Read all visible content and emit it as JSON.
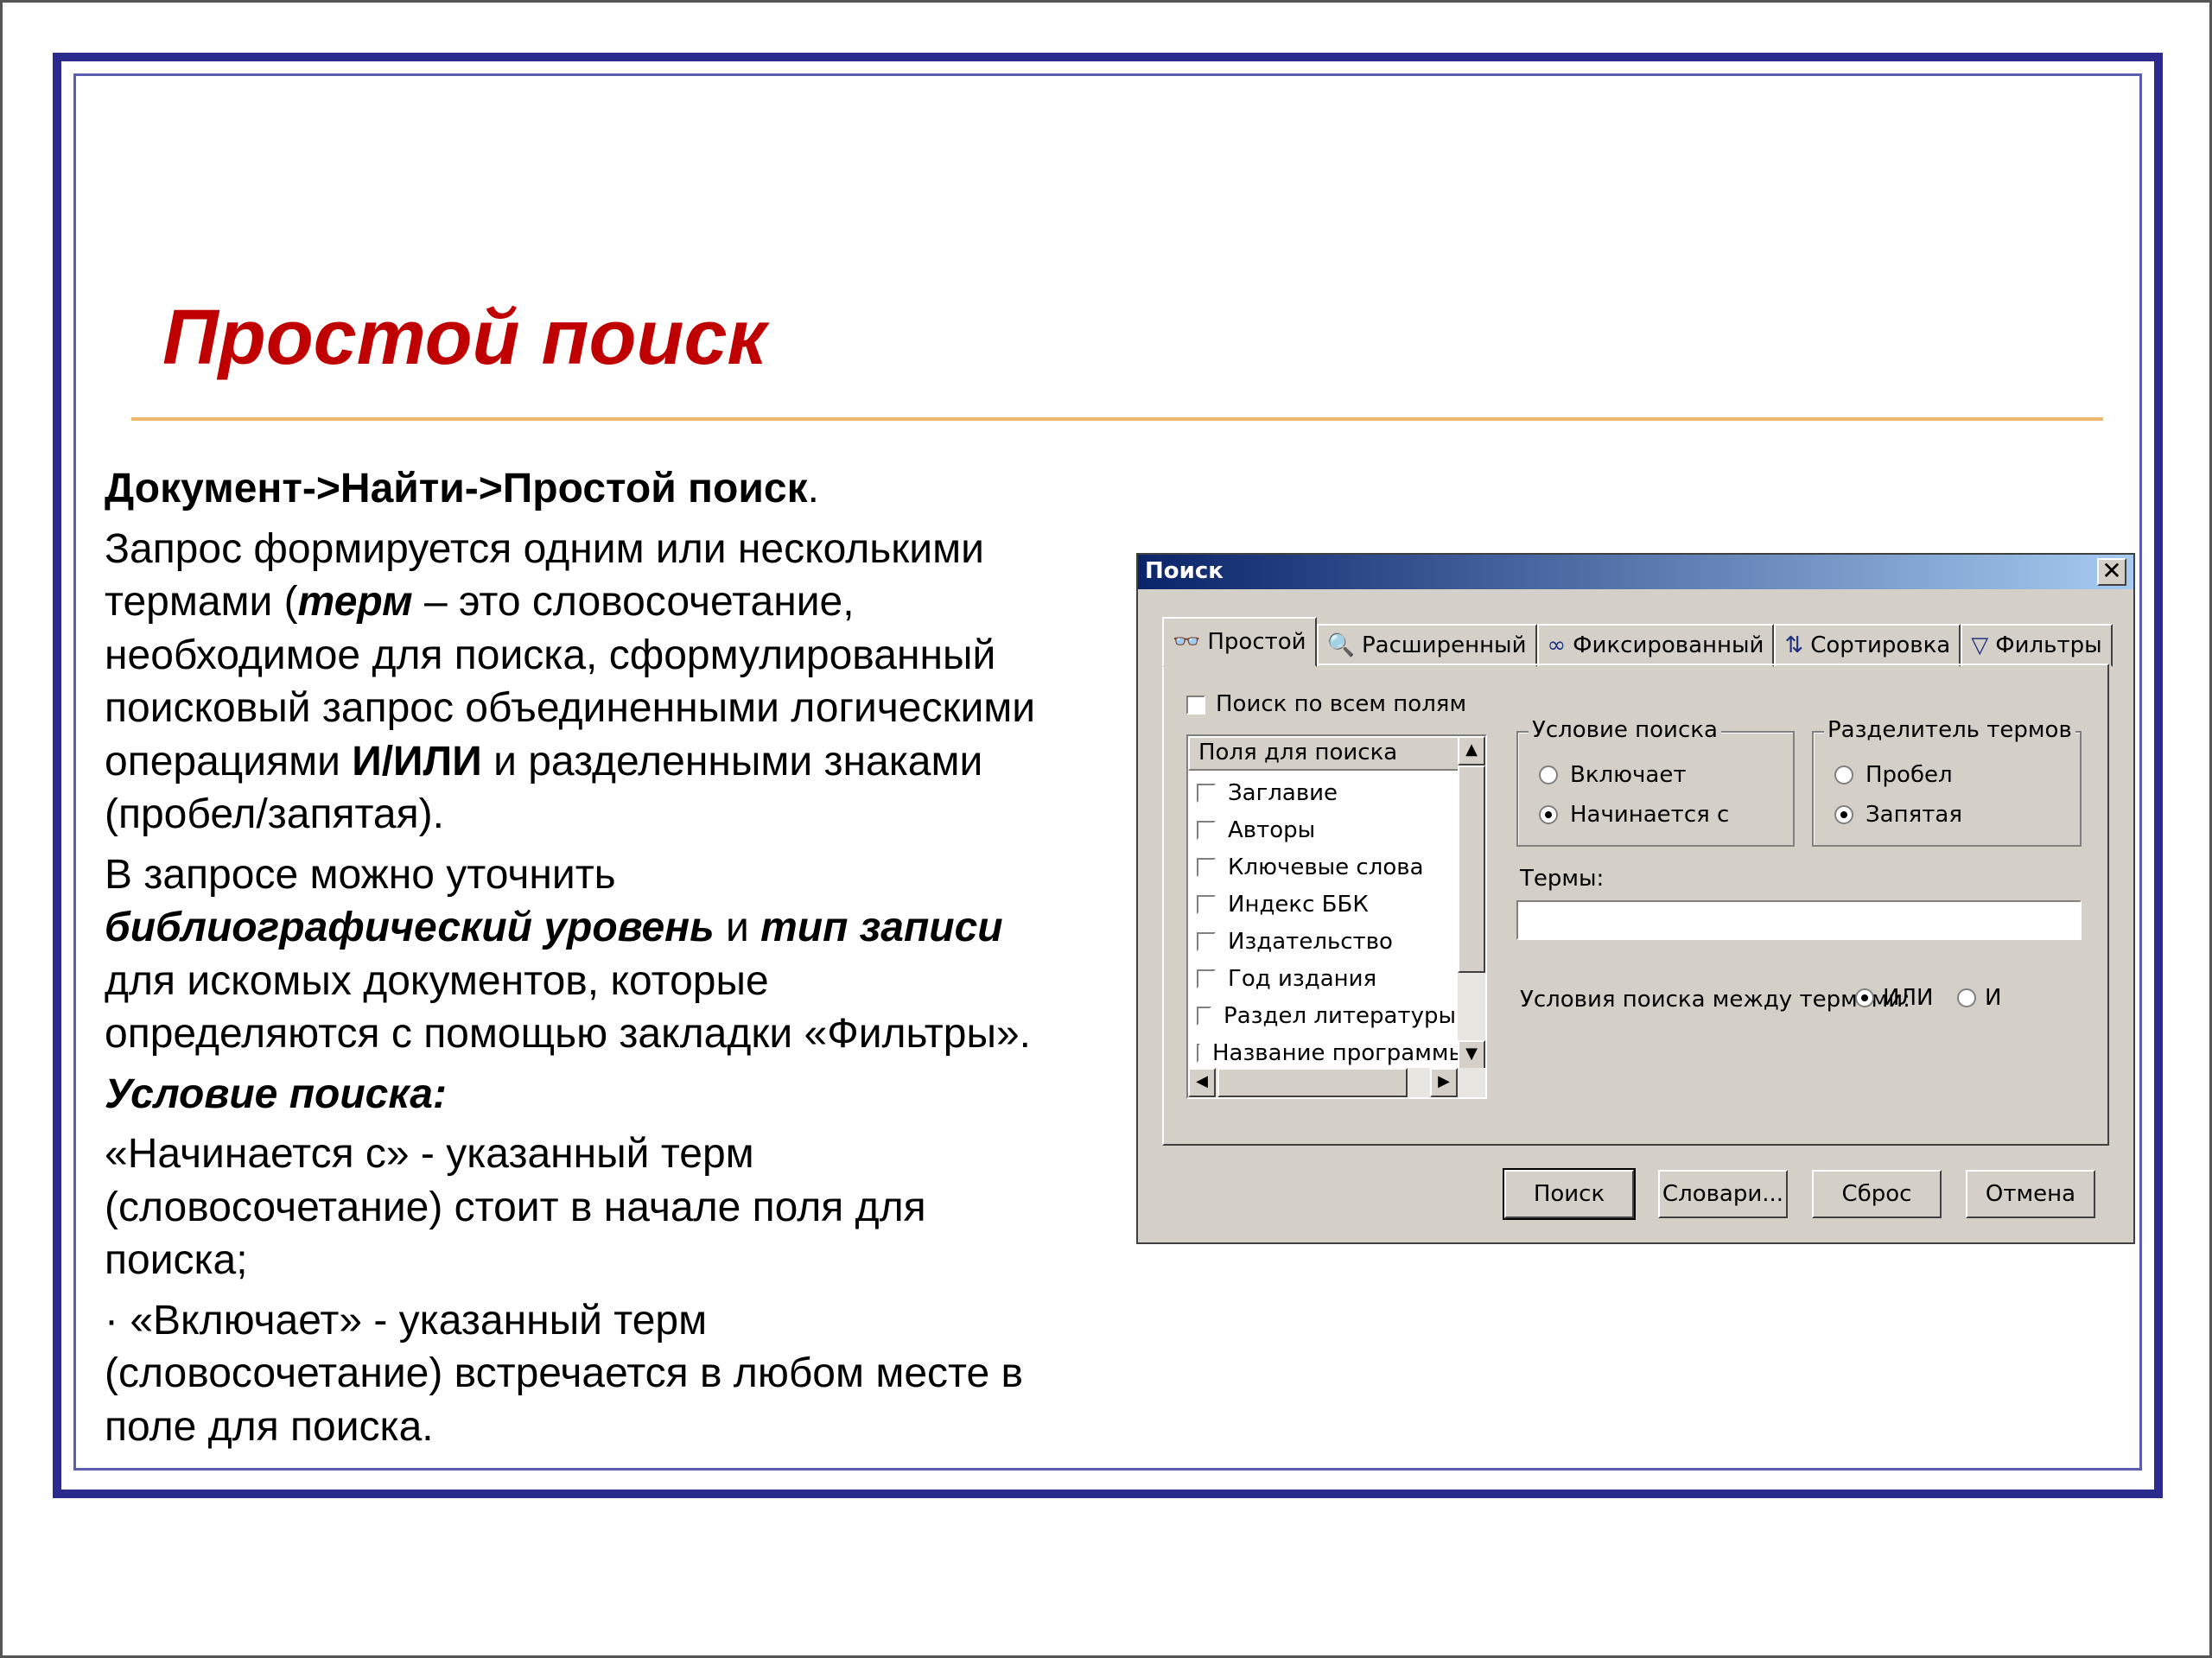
{
  "slide": {
    "title": "Простой поиск",
    "path": "Документ->Найти->Простой поиск",
    "path_dot": ".",
    "p1_a": "Запрос формируется одним или несколькими",
    "p1_b": "термами (",
    "p1_term": "терм",
    "p1_c": " – это словосочетание,",
    "p1_d": "необходимое для поиска, сформулированный",
    "p1_e": "поисковый запрос объединенными логическими",
    "p1_f": "операциями ",
    "p1_andor": "И/ИЛИ",
    "p1_g": " и разделенными знаками",
    "p1_h": "(пробел/запятая).",
    "p2_a": "В запросе можно уточнить",
    "p2_level": "библиографический уровень",
    "p2_and": " и ",
    "p2_type": "тип записи",
    "p2_b": "для искомых документов, которые",
    "p2_c": "определяются с помощью закладки «Фильтры».",
    "cond_heading": "Условие поиска:",
    "p3_a": "«Начинается с» -  указанный терм",
    "p3_b": "(словосочетание) стоит в начале поля для",
    "p3_c": "поиска;",
    "p4_a": "· «Включает» - указанный терм",
    "p4_b": "(словосочетание) встречается в любом месте в",
    "p4_c": "поле для поиска."
  },
  "dialog": {
    "title": "Поиск",
    "close": "✕",
    "tabs": [
      {
        "label": "Простой",
        "icon": "binoculars-icon",
        "glyph": "👓"
      },
      {
        "label": "Расширенный",
        "icon": "search-doc-icon",
        "glyph": "🔍"
      },
      {
        "label": "Фиксированный",
        "icon": "glasses-icon",
        "glyph": "∞"
      },
      {
        "label": "Сортировка",
        "icon": "sort-icon",
        "glyph": "⇅"
      },
      {
        "label": "Фильтры",
        "icon": "filter-icon",
        "glyph": "▽"
      }
    ],
    "all_fields": "Поиск по всем полям",
    "fields_header": "Поля для поиска",
    "fields": [
      "Заглавие",
      "Авторы",
      "Ключевые слова",
      "Индекс ББК",
      "Издательство",
      "Год издания",
      "Раздел литературы",
      "Название программы"
    ],
    "condition": {
      "legend": "Условие поиска",
      "options": [
        "Включает",
        "Начинается с"
      ],
      "selected": 1
    },
    "separator": {
      "legend": "Разделитель термов",
      "options": [
        "Пробел",
        "Запятая"
      ],
      "selected": 1
    },
    "terms_label": "Термы:",
    "terms_value": "",
    "between_label": "Условия поиска между термами:",
    "between_options": [
      "ИЛИ",
      "И"
    ],
    "between_selected": 0,
    "buttons": {
      "search": "Поиск",
      "dicts": "Словари...",
      "reset": "Сброс",
      "cancel": "Отмена"
    }
  },
  "colors": {
    "title": "#c00000",
    "frame": "#2b2b8e",
    "rule": "#f0b86a",
    "dialog_bg": "#d4d0c8",
    "titlebar": "#0a246a"
  }
}
